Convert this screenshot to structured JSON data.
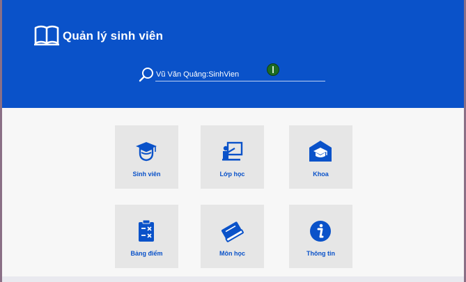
{
  "app": {
    "title": "Quản lý sinh viên",
    "accent_color": "#0a52c9",
    "logo_icon": "open-book-icon"
  },
  "search": {
    "value": "Vũ Văn Quảng:SinhVien",
    "icon": "search-icon"
  },
  "menu": {
    "tiles": [
      {
        "label": "Sinh viên",
        "icon": "student-graduate-icon"
      },
      {
        "label": "Lớp học",
        "icon": "classroom-teacher-icon"
      },
      {
        "label": "Khoa",
        "icon": "faculty-school-icon"
      },
      {
        "label": "Bảng điểm",
        "icon": "gradebook-clipboard-icon"
      },
      {
        "label": "Môn học",
        "icon": "subject-book-icon"
      },
      {
        "label": "Thông tin",
        "icon": "info-icon"
      }
    ]
  }
}
